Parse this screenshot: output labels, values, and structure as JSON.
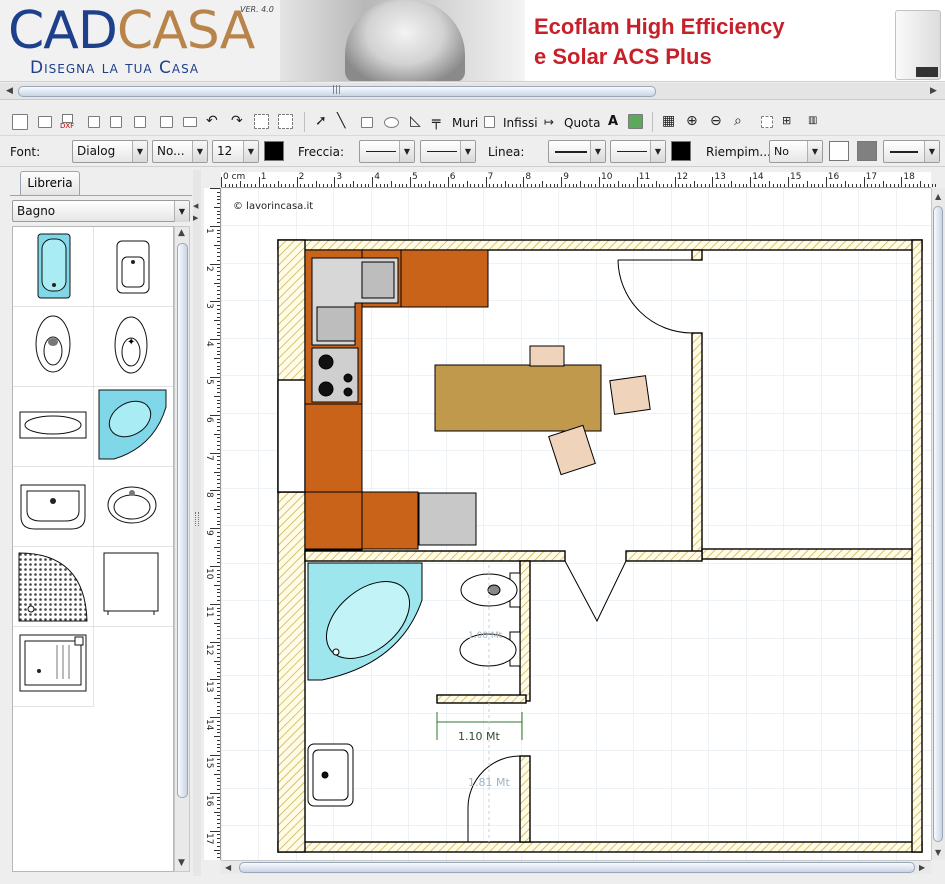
{
  "banner": {
    "logo_cad": "CAD",
    "logo_casa": "CASA",
    "version": "VER. 4.0",
    "tagline": "Disegna la tua Casa",
    "ad_line1": "Ecoflam High Efficiency",
    "ad_line2": "e Solar ACS Plus"
  },
  "toolbar": {
    "dxf_label": "DXF",
    "muri_label": "Muri",
    "infissi_label": "Infissi",
    "quota_label": "Quota",
    "text_tool_label": "A"
  },
  "format_bar": {
    "font_label": "Font:",
    "font_family_value": "Dialog",
    "font_style_value": "No...",
    "font_size_value": "12",
    "freccia_label": "Freccia:",
    "linea_label": "Linea:",
    "riempimento_label": "Riempim...",
    "fill_value": "No",
    "colors": {
      "font_color": "#000000",
      "line_color": "#000000",
      "fill_color": "#ffffff",
      "fill_color2": "#808080"
    }
  },
  "library": {
    "tab_label": "Libreria",
    "category_value": "Bagno",
    "items": [
      "vasca",
      "bidet",
      "wc",
      "bidet-sospeso",
      "vasca-idromassaggio",
      "vasca-angolare",
      "lavabo",
      "lavabo-ovale",
      "piatto-doccia",
      "mobile",
      "lavatoio"
    ]
  },
  "drawing": {
    "credit": "© lavorincasa.it",
    "dimension_1": "1.10 Mt",
    "dimension_2": "1.81 Mt",
    "dimension_3": "1.00 Mt",
    "ruler_top_labels": [
      "0 cm",
      "1",
      "2",
      "3",
      "4",
      "5",
      "6",
      "7",
      "8",
      "9",
      "10",
      "11",
      "12",
      "13",
      "14",
      "15",
      "16",
      "17",
      "18"
    ],
    "ruler_left_labels": [
      "1",
      "2",
      "3",
      "4",
      "5",
      "6",
      "7",
      "8",
      "9",
      "10",
      "11",
      "12",
      "13",
      "14",
      "15",
      "16",
      "17"
    ]
  }
}
